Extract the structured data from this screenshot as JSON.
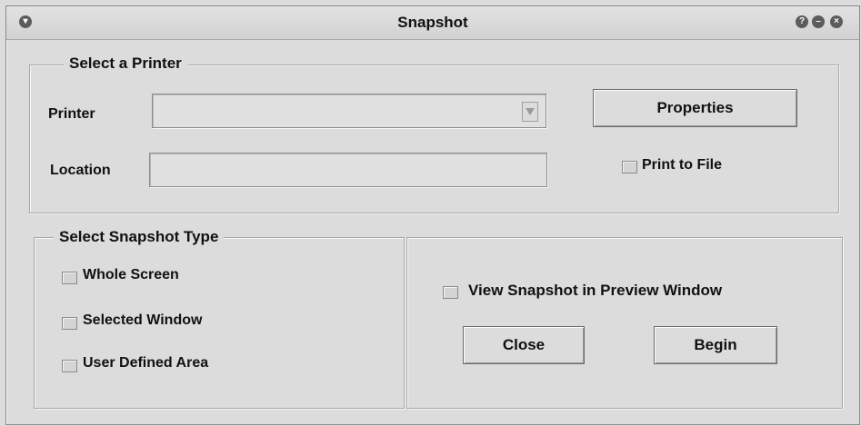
{
  "window": {
    "title": "Snapshot"
  },
  "printer_group": {
    "legend": "Select a Printer",
    "printer_label": "Printer",
    "printer_value": "",
    "location_label": "Location",
    "location_value": "",
    "properties_label": "Properties",
    "print_to_file_label": "Print to File"
  },
  "type_group": {
    "legend": "Select Snapshot Type",
    "options": [
      "Whole Screen",
      "Selected Window",
      "User Defined Area"
    ]
  },
  "preview": {
    "view_label": "View Snapshot in Preview Window",
    "close_label": "Close",
    "begin_label": "Begin"
  },
  "icons": [
    "menu-icon",
    "help-icon",
    "minimize-icon",
    "close-icon",
    "chevron-down-icon"
  ],
  "colors": {
    "background": "#dcdcdc",
    "border": "#a8a8a8",
    "title_button": "#5c5c5c"
  }
}
